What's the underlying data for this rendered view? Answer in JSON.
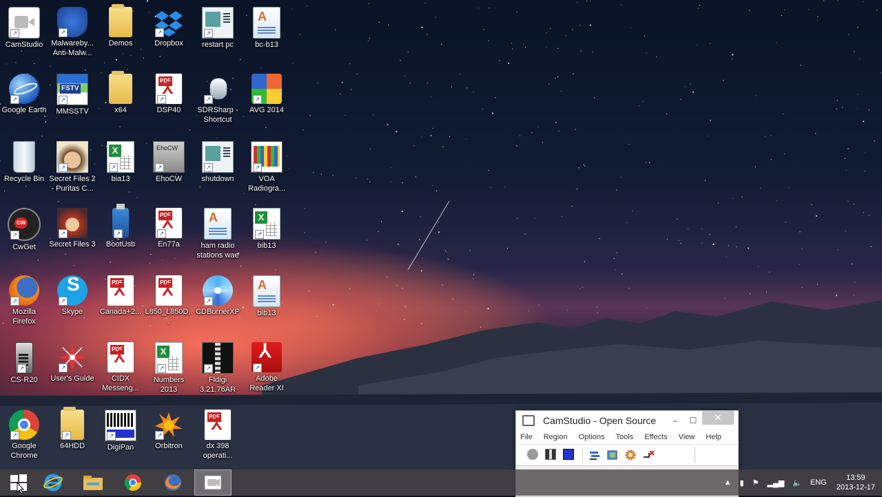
{
  "desktop": {
    "icons": [
      {
        "label": "CamStudio",
        "kind": "camstudio",
        "shortcut": true
      },
      {
        "label": "Google Earth",
        "kind": "earth",
        "shortcut": true
      },
      {
        "label": "Recycle Bin",
        "kind": "recycle",
        "shortcut": false
      },
      {
        "label": "CwGet",
        "kind": "cwget",
        "shortcut": true
      },
      {
        "label": "Mozilla Firefox",
        "kind": "firefox",
        "shortcut": true
      },
      {
        "label": "CS-R20",
        "kind": "csr20",
        "shortcut": true
      },
      {
        "label": "Google Chrome",
        "kind": "chrome",
        "shortcut": true
      },
      {
        "label": "Malwareby... Anti-Malw...",
        "kind": "malwarebytes",
        "shortcut": true
      },
      {
        "label": "MMSSTV",
        "kind": "mmsstv",
        "shortcut": true
      },
      {
        "label": "Secret Files 2 - Puritas C...",
        "kind": "face",
        "shortcut": true
      },
      {
        "label": "Secret Files 3",
        "kind": "face2",
        "shortcut": true
      },
      {
        "label": "Skype",
        "kind": "skype",
        "shortcut": true
      },
      {
        "label": "User's Guide",
        "kind": "compass",
        "shortcut": true
      },
      {
        "label": "64HDD",
        "kind": "folder",
        "shortcut": true
      },
      {
        "label": "Demos",
        "kind": "folder",
        "shortcut": false
      },
      {
        "label": "x64",
        "kind": "folder",
        "shortcut": false
      },
      {
        "label": "bia13",
        "kind": "xls",
        "shortcut": true
      },
      {
        "label": "BootUsb",
        "kind": "usb",
        "shortcut": true
      },
      {
        "label": "Canada+2...",
        "kind": "pdf",
        "shortcut": false
      },
      {
        "label": "CIDX Messeng...",
        "kind": "pdf",
        "shortcut": false
      },
      {
        "label": "DigiPan",
        "kind": "digipan",
        "shortcut": true
      },
      {
        "label": "Dropbox",
        "kind": "dropbox",
        "shortcut": true
      },
      {
        "label": "DSP40",
        "kind": "pdf",
        "shortcut": true
      },
      {
        "label": "EhoCW",
        "kind": "ehocw",
        "shortcut": true
      },
      {
        "label": "En77a",
        "kind": "pdf",
        "shortcut": true
      },
      {
        "label": "L850_L850D...",
        "kind": "pdf",
        "shortcut": false
      },
      {
        "label": "Numbers 2013",
        "kind": "xls",
        "shortcut": true
      },
      {
        "label": "Orbitron",
        "kind": "orbitron",
        "shortcut": true
      },
      {
        "label": "restart pc",
        "kind": "screen",
        "shortcut": true
      },
      {
        "label": "SDRSharp - Shortcut",
        "kind": "mouse",
        "shortcut": true
      },
      {
        "label": "shutdown",
        "kind": "screen",
        "shortcut": true
      },
      {
        "label": "ham radio stations wae",
        "kind": "doc",
        "shortcut": false
      },
      {
        "label": "CDBurnerXP",
        "kind": "cd",
        "shortcut": true
      },
      {
        "label": "Fldigi 3.21.76AR",
        "kind": "fldigi",
        "shortcut": true
      },
      {
        "label": "dx 398 operati...",
        "kind": "pdf",
        "shortcut": false
      },
      {
        "label": "bc-b13",
        "kind": "doc",
        "shortcut": false
      },
      {
        "label": "AVG 2014",
        "kind": "avg",
        "shortcut": true
      },
      {
        "label": "VOA Radiogra...",
        "kind": "voa",
        "shortcut": true
      },
      {
        "label": "bib13",
        "kind": "xls",
        "shortcut": true
      },
      {
        "label": "bib13",
        "kind": "doc",
        "shortcut": false
      },
      {
        "label": "Adobe Reader XI",
        "kind": "adobe",
        "shortcut": true
      }
    ]
  },
  "camstudio_window": {
    "title": "CamStudio - Open Source",
    "minimize": "–",
    "maximize": "☐",
    "close": "✕",
    "menu": [
      "File",
      "Region",
      "Options",
      "Tools",
      "Effects",
      "View",
      "Help"
    ],
    "toolbar": [
      "record-button",
      "pause-button",
      "stop-button",
      "region-button",
      "screen-annotation-button",
      "video-annotation-button",
      "options-button"
    ]
  },
  "taskbar": {
    "pinned": [
      "start",
      "internet-explorer",
      "file-explorer",
      "chrome",
      "firefox",
      "camstudio"
    ],
    "tray": {
      "language": "ENG",
      "time": "13:59",
      "date": "2013-12-17"
    }
  },
  "colors": {
    "accent": "#2f6fd6",
    "taskbar": "#464244"
  }
}
